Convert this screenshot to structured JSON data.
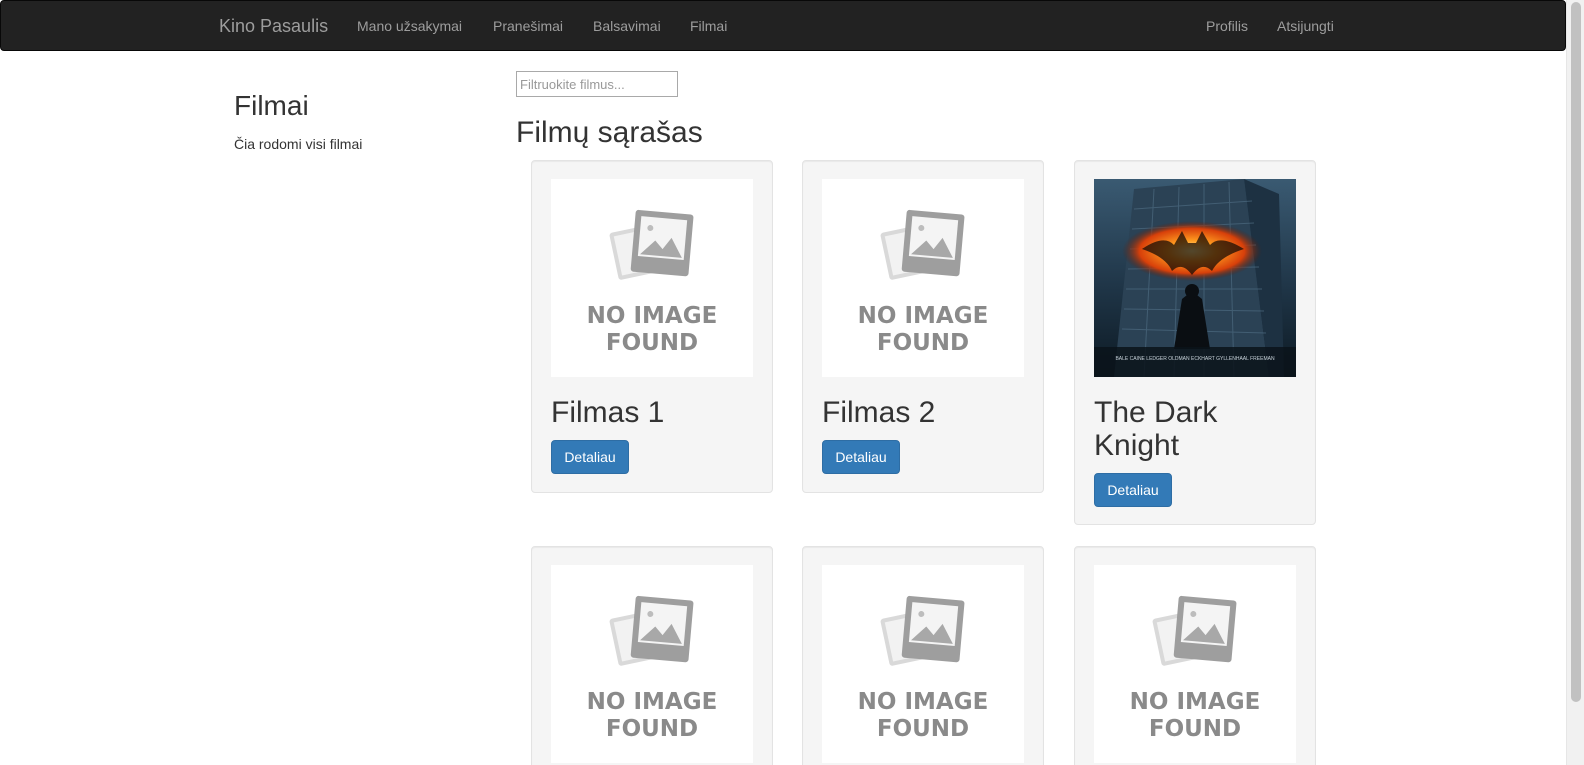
{
  "navbar": {
    "brand": "Kino Pasaulis",
    "left_links": [
      "Mano užsakymai",
      "Pranešimai",
      "Balsavimai",
      "Filmai"
    ],
    "right_links": [
      "Profilis",
      "Atsijungti"
    ]
  },
  "sidebar": {
    "title": "Filmai",
    "description": "Čia rodomi visi filmai"
  },
  "filter": {
    "placeholder": "Filtruokite filmus..."
  },
  "list_title": "Filmų sąrašas",
  "no_image_text": {
    "line1": "NO IMAGE",
    "line2": "FOUND"
  },
  "movies": [
    {
      "title": "Filmas 1",
      "button": "Detaliau",
      "image": "no-image"
    },
    {
      "title": "Filmas 2",
      "button": "Detaliau",
      "image": "no-image"
    },
    {
      "title": "The Dark Knight",
      "button": "Detaliau",
      "image": "poster",
      "poster_credits": "BALE  CAINE  LEDGER  OLDMAN  ECKHART  GYLLENHAAL  FREEMAN"
    },
    {
      "title": "",
      "button": "",
      "image": "no-image"
    },
    {
      "title": "",
      "button": "",
      "image": "no-image"
    },
    {
      "title": "",
      "button": "",
      "image": "no-image"
    }
  ],
  "colors": {
    "navbar_bg": "#222222",
    "nav_text": "#9d9d9d",
    "primary_button": "#337ab7",
    "card_bg": "#f5f5f5"
  }
}
